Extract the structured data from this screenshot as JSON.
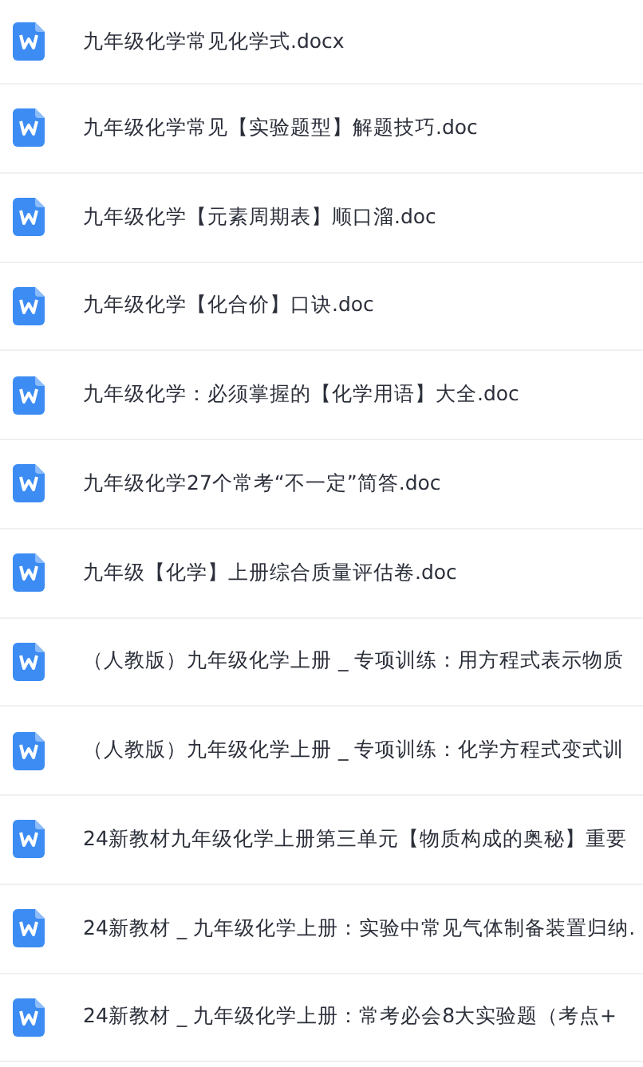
{
  "files": [
    {
      "name": "九年级化学常见化学式.docx"
    },
    {
      "name": "九年级化学常见【实验题型】解题技巧.doc"
    },
    {
      "name": "九年级化学【元素周期表】顺口溜.doc"
    },
    {
      "name": "九年级化学【化合价】口诀.doc"
    },
    {
      "name": "九年级化学：必须掌握的【化学用语】大全.doc"
    },
    {
      "name": "九年级化学27个常考“不一定”简答.doc"
    },
    {
      "name": "九年级【化学】上册综合质量评估卷.doc"
    },
    {
      "name": "（人教版）九年级化学上册 _ 专项训练：用方程式表示物质"
    },
    {
      "name": "（人教版）九年级化学上册 _ 专项训练：化学方程式变式训"
    },
    {
      "name": "24新教材九年级化学上册第三单元【物质构成的奥秘】重要"
    },
    {
      "name": "24新教材 _ 九年级化学上册：实验中常见气体制备装置归纳."
    },
    {
      "name": "24新教材 _ 九年级化学上册：常考必会8大实验题（考点+"
    }
  ]
}
